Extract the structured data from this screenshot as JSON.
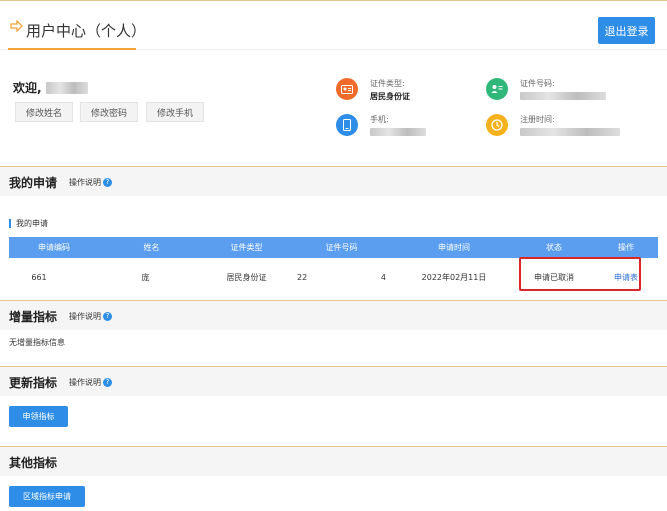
{
  "header": {
    "title": "用户中心（个人）",
    "logout_label": "退出登录"
  },
  "profile": {
    "welcome": "欢迎,",
    "buttons": [
      "修改姓名",
      "修改密码",
      "修改手机"
    ],
    "info": [
      {
        "label": "证件类型:",
        "value": "居民身份证",
        "icon": "id-card-icon",
        "color": "#f06a2a"
      },
      {
        "label": "证件号码:",
        "value": "",
        "icon": "contact-icon",
        "color": "#2fb87a"
      },
      {
        "label": "手机:",
        "value": "",
        "icon": "phone-icon",
        "color": "#2e8de6"
      },
      {
        "label": "注册时间:",
        "value": "",
        "icon": "clock-icon",
        "color": "#f5b21c"
      }
    ]
  },
  "my_applications": {
    "title": "我的申请",
    "help": "操作说明",
    "subtitle": "我的申请",
    "columns": [
      "申请编码",
      "姓名",
      "证件类型",
      "证件号码",
      "申请时间",
      "状态",
      "操作"
    ],
    "rows": [
      {
        "code": "661",
        "name": "庞",
        "id_type": "居民身份证",
        "id_no_a": "22",
        "id_no_b": "4",
        "time": "2022年02月11日",
        "status": "申请已取消",
        "action": "申请表"
      }
    ]
  },
  "increment": {
    "title": "增量指标",
    "help": "操作说明",
    "empty_text": "无增量指标信息"
  },
  "update": {
    "title": "更新指标",
    "help": "操作说明",
    "button": "申领指标"
  },
  "other": {
    "title": "其他指标",
    "button": "区域指标申请"
  },
  "colors": {
    "accent": "#f2a33a",
    "primary": "#2e8de6",
    "table_header": "#5b9ef0",
    "highlight": "#d9262c"
  }
}
